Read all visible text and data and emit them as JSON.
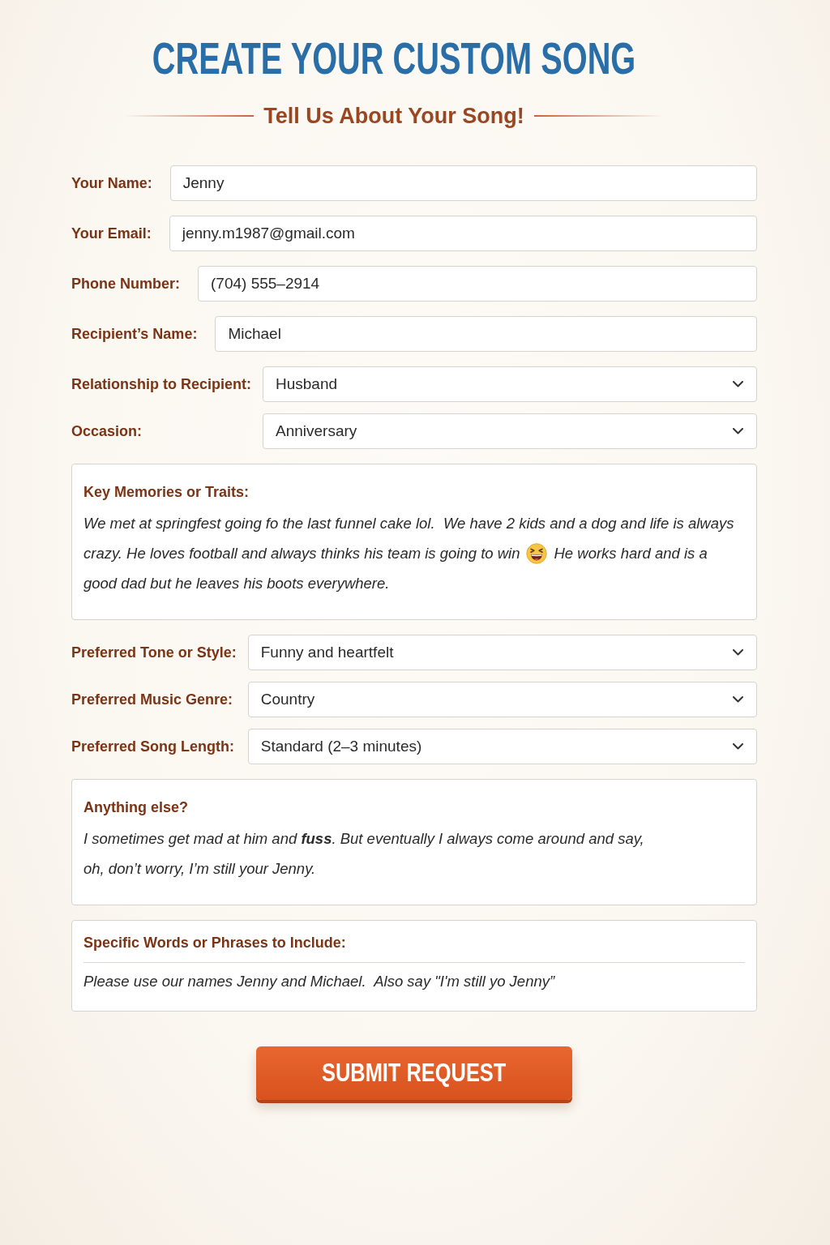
{
  "header": {
    "title": "CREATE YOUR CUSTOM SONG",
    "subtitle": "Tell Us About Your Song!"
  },
  "form": [
    {
      "kind": "text",
      "label": "Your Name:",
      "value": "Jenny"
    },
    {
      "kind": "text",
      "label": "Your Email:",
      "value": "jenny.m1987@gmail.com"
    },
    {
      "kind": "text",
      "label": "Phone Number:",
      "value": "(704) 555–2914"
    },
    {
      "kind": "text",
      "label": "Recipient’s Name:",
      "value": "Michael"
    },
    {
      "kind": "select",
      "label": "Relationship to Recipient:",
      "value": "Husband"
    },
    {
      "kind": "select",
      "label": "Occasion:",
      "value": "Anniversary"
    },
    {
      "kind": "textarea",
      "label": "Key Memories or Traits:",
      "divider": false,
      "lines": [
        {
          "segments": [
            {
              "kind": "text",
              "text": "We met at springfest going fo the last funnel cake lol.  We have 2 kids and a dog and life is always"
            }
          ]
        },
        {
          "segments": [
            {
              "kind": "text",
              "text": "crazy. He loves football and always thinks his team is going to win"
            },
            {
              "kind": "emoji"
            },
            {
              "kind": "text",
              "text": "He works hard and is a"
            }
          ]
        },
        {
          "segments": [
            {
              "kind": "text",
              "text": "good dad but he leaves his boots everywhere."
            }
          ]
        }
      ]
    },
    {
      "kind": "select",
      "label": "Preferred Tone or Style:",
      "value": "Funny and heartfelt"
    },
    {
      "kind": "select",
      "label": "Preferred Music Genre:",
      "value": "Country"
    },
    {
      "kind": "select",
      "label": "Preferred Song Length:",
      "value": "Standard (2–3 minutes)"
    },
    {
      "kind": "textarea",
      "label": "Anything else?",
      "divider": false,
      "lines": [
        {
          "segments": [
            {
              "kind": "text",
              "text": "I sometimes get mad at him and **fuss**. But eventually I always come around and say,"
            }
          ]
        },
        {
          "segments": [
            {
              "kind": "text",
              "text": "oh, don’t worry, I’m still your Jenny."
            }
          ]
        }
      ]
    },
    {
      "kind": "textarea",
      "label": "Specific Words or Phrases to Include:",
      "divider": true,
      "lines": [
        {
          "segments": [
            {
              "kind": "text",
              "text": "Please use our names Jenny and Michael.  Also say \"I'm still yo Jenny”"
            }
          ]
        }
      ]
    }
  ],
  "submit": {
    "label": "SUBMIT REQUEST"
  }
}
